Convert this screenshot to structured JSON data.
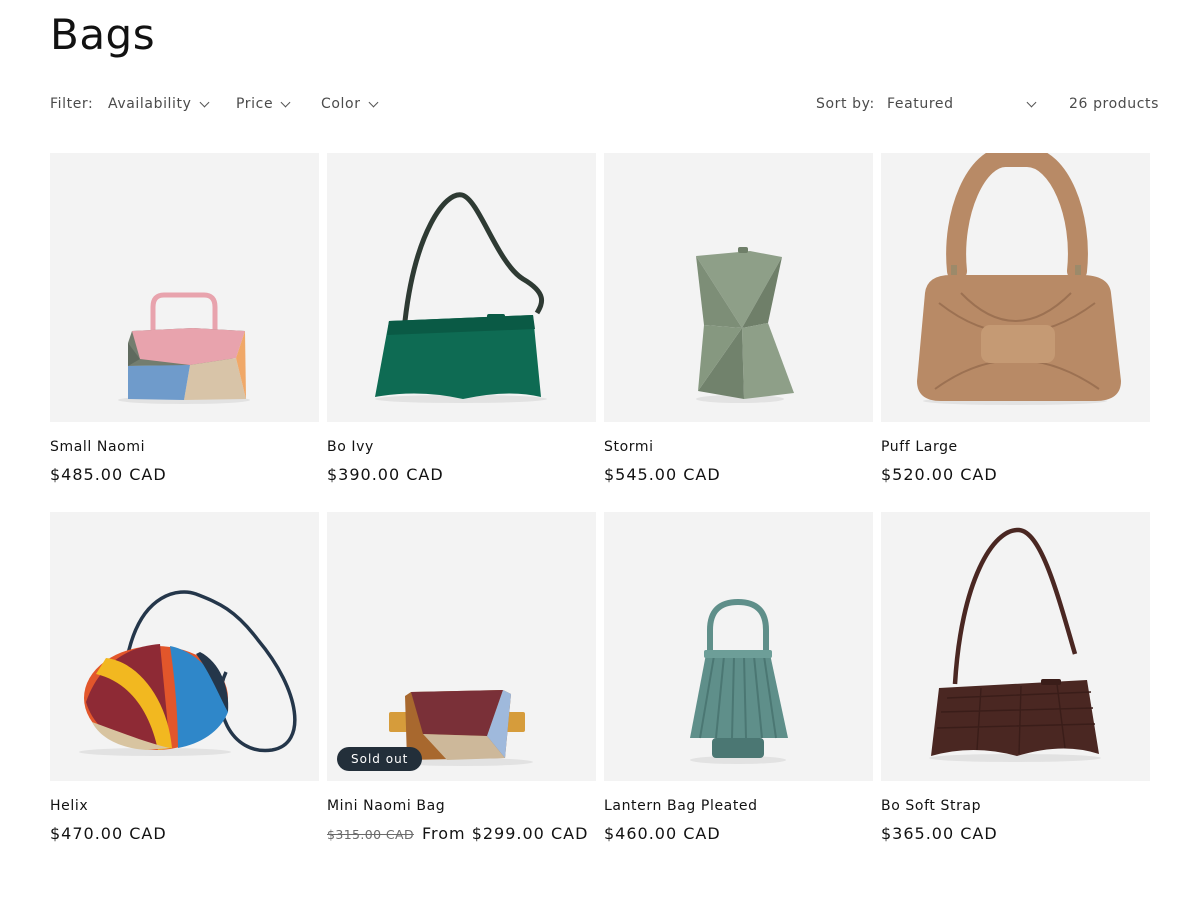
{
  "page": {
    "title": "Bags"
  },
  "filters": {
    "label": "Filter:",
    "availability": "Availability",
    "price": "Price",
    "color": "Color"
  },
  "sort": {
    "label": "Sort by:",
    "selected": "Featured"
  },
  "product_count": "26 products",
  "products": [
    {
      "name": "Small Naomi",
      "price": "$485.00 CAD",
      "image": "small-naomi-bag-image",
      "colors": [
        "#e8a3ad",
        "#d8c4a8",
        "#6f9bcb",
        "#f0a868",
        "#737d6f"
      ]
    },
    {
      "name": "Bo Ivy",
      "price": "$390.00 CAD",
      "image": "bo-ivy-bag-image",
      "colors": [
        "#0e6b53",
        "#2e3a33"
      ]
    },
    {
      "name": "Stormi",
      "price": "$545.00 CAD",
      "image": "stormi-bag-image",
      "colors": [
        "#8e9f88",
        "#6f7f69"
      ]
    },
    {
      "name": "Puff Large",
      "price": "$520.00 CAD",
      "image": "puff-large-bag-image",
      "colors": [
        "#b88a66",
        "#9c7152"
      ]
    },
    {
      "name": "Helix",
      "price": "$470.00 CAD",
      "image": "helix-bag-image",
      "colors": [
        "#2f87c9",
        "#e2562b",
        "#8e2a35",
        "#d8c4a0",
        "#f2b820",
        "#24364a"
      ]
    },
    {
      "name": "Mini Naomi Bag",
      "price_old": "$315.00 CAD",
      "price": "From $299.00 CAD",
      "badge": "Sold out",
      "image": "mini-naomi-bag-image",
      "colors": [
        "#7a3038",
        "#a8682e",
        "#cdb89a",
        "#9fb9dc",
        "#d69c3b"
      ]
    },
    {
      "name": "Lantern Bag Pleated",
      "price": "$460.00 CAD",
      "image": "lantern-bag-image",
      "colors": [
        "#5f8f8a",
        "#4b7773"
      ]
    },
    {
      "name": "Bo Soft Strap",
      "price": "$365.00 CAD",
      "image": "bo-soft-strap-bag-image",
      "colors": [
        "#4a2722",
        "#3a1d19"
      ]
    }
  ]
}
